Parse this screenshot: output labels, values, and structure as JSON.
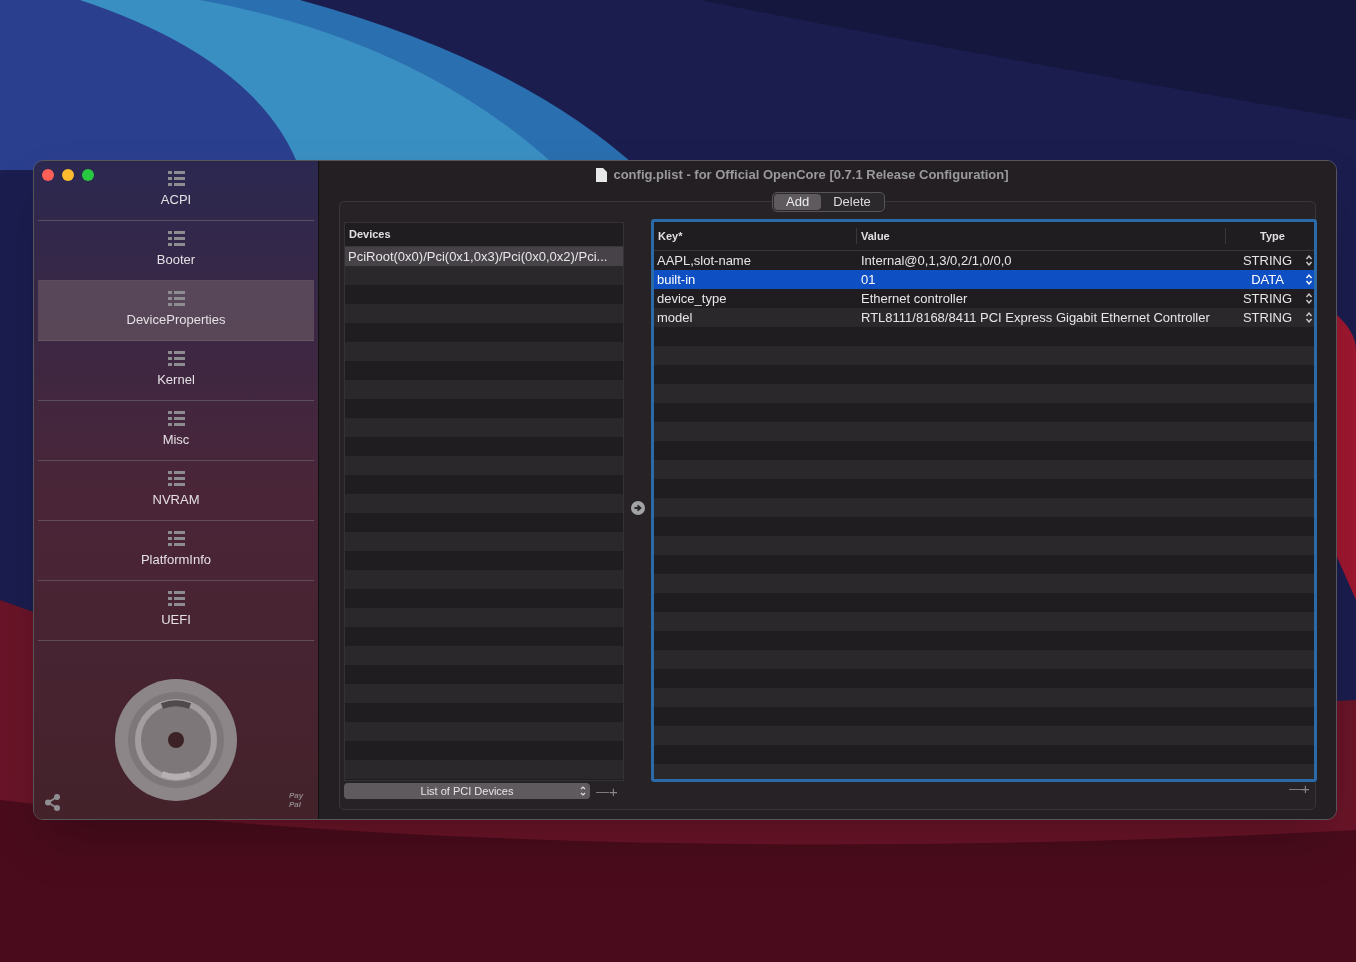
{
  "window": {
    "title": "config.plist - for Official OpenCore [0.7.1 Release Configuration]"
  },
  "sidebar": {
    "items": [
      {
        "label": "ACPI",
        "selected": false
      },
      {
        "label": "Booter",
        "selected": false
      },
      {
        "label": "DeviceProperties",
        "selected": true
      },
      {
        "label": "Kernel",
        "selected": false
      },
      {
        "label": "Misc",
        "selected": false
      },
      {
        "label": "NVRAM",
        "selected": false
      },
      {
        "label": "PlatformInfo",
        "selected": false
      },
      {
        "label": "UEFI",
        "selected": false
      }
    ],
    "paypal_label": "Pay Pal"
  },
  "segmented": [
    {
      "label": "Add",
      "selected": true
    },
    {
      "label": "Delete",
      "selected": false
    }
  ],
  "devices_table": {
    "columns": [
      "Devices"
    ],
    "rows": [
      {
        "device": "PciRoot(0x0)/Pci(0x1,0x3)/Pci(0x0,0x2)/Pci...",
        "selected": true
      }
    ],
    "popup": "List of PCI Devices",
    "remove": "—",
    "add": "+"
  },
  "properties_table": {
    "columns": [
      "Key*",
      "Value",
      "Type"
    ],
    "rows": [
      {
        "key": "AAPL,slot-name",
        "value": "Internal@0,1,3/0,2/1,0/0,0",
        "type": "STRING",
        "selected": false
      },
      {
        "key": "built-in",
        "value": "01",
        "type": "DATA",
        "selected": true
      },
      {
        "key": "device_type",
        "value": "Ethernet controller",
        "type": "STRING",
        "selected": false
      },
      {
        "key": "model",
        "value": "RTL8111/8168/8411 PCI Express Gigabit Ethernet Controller",
        "type": "STRING",
        "selected": false
      }
    ],
    "remove": "—",
    "add": "+"
  }
}
